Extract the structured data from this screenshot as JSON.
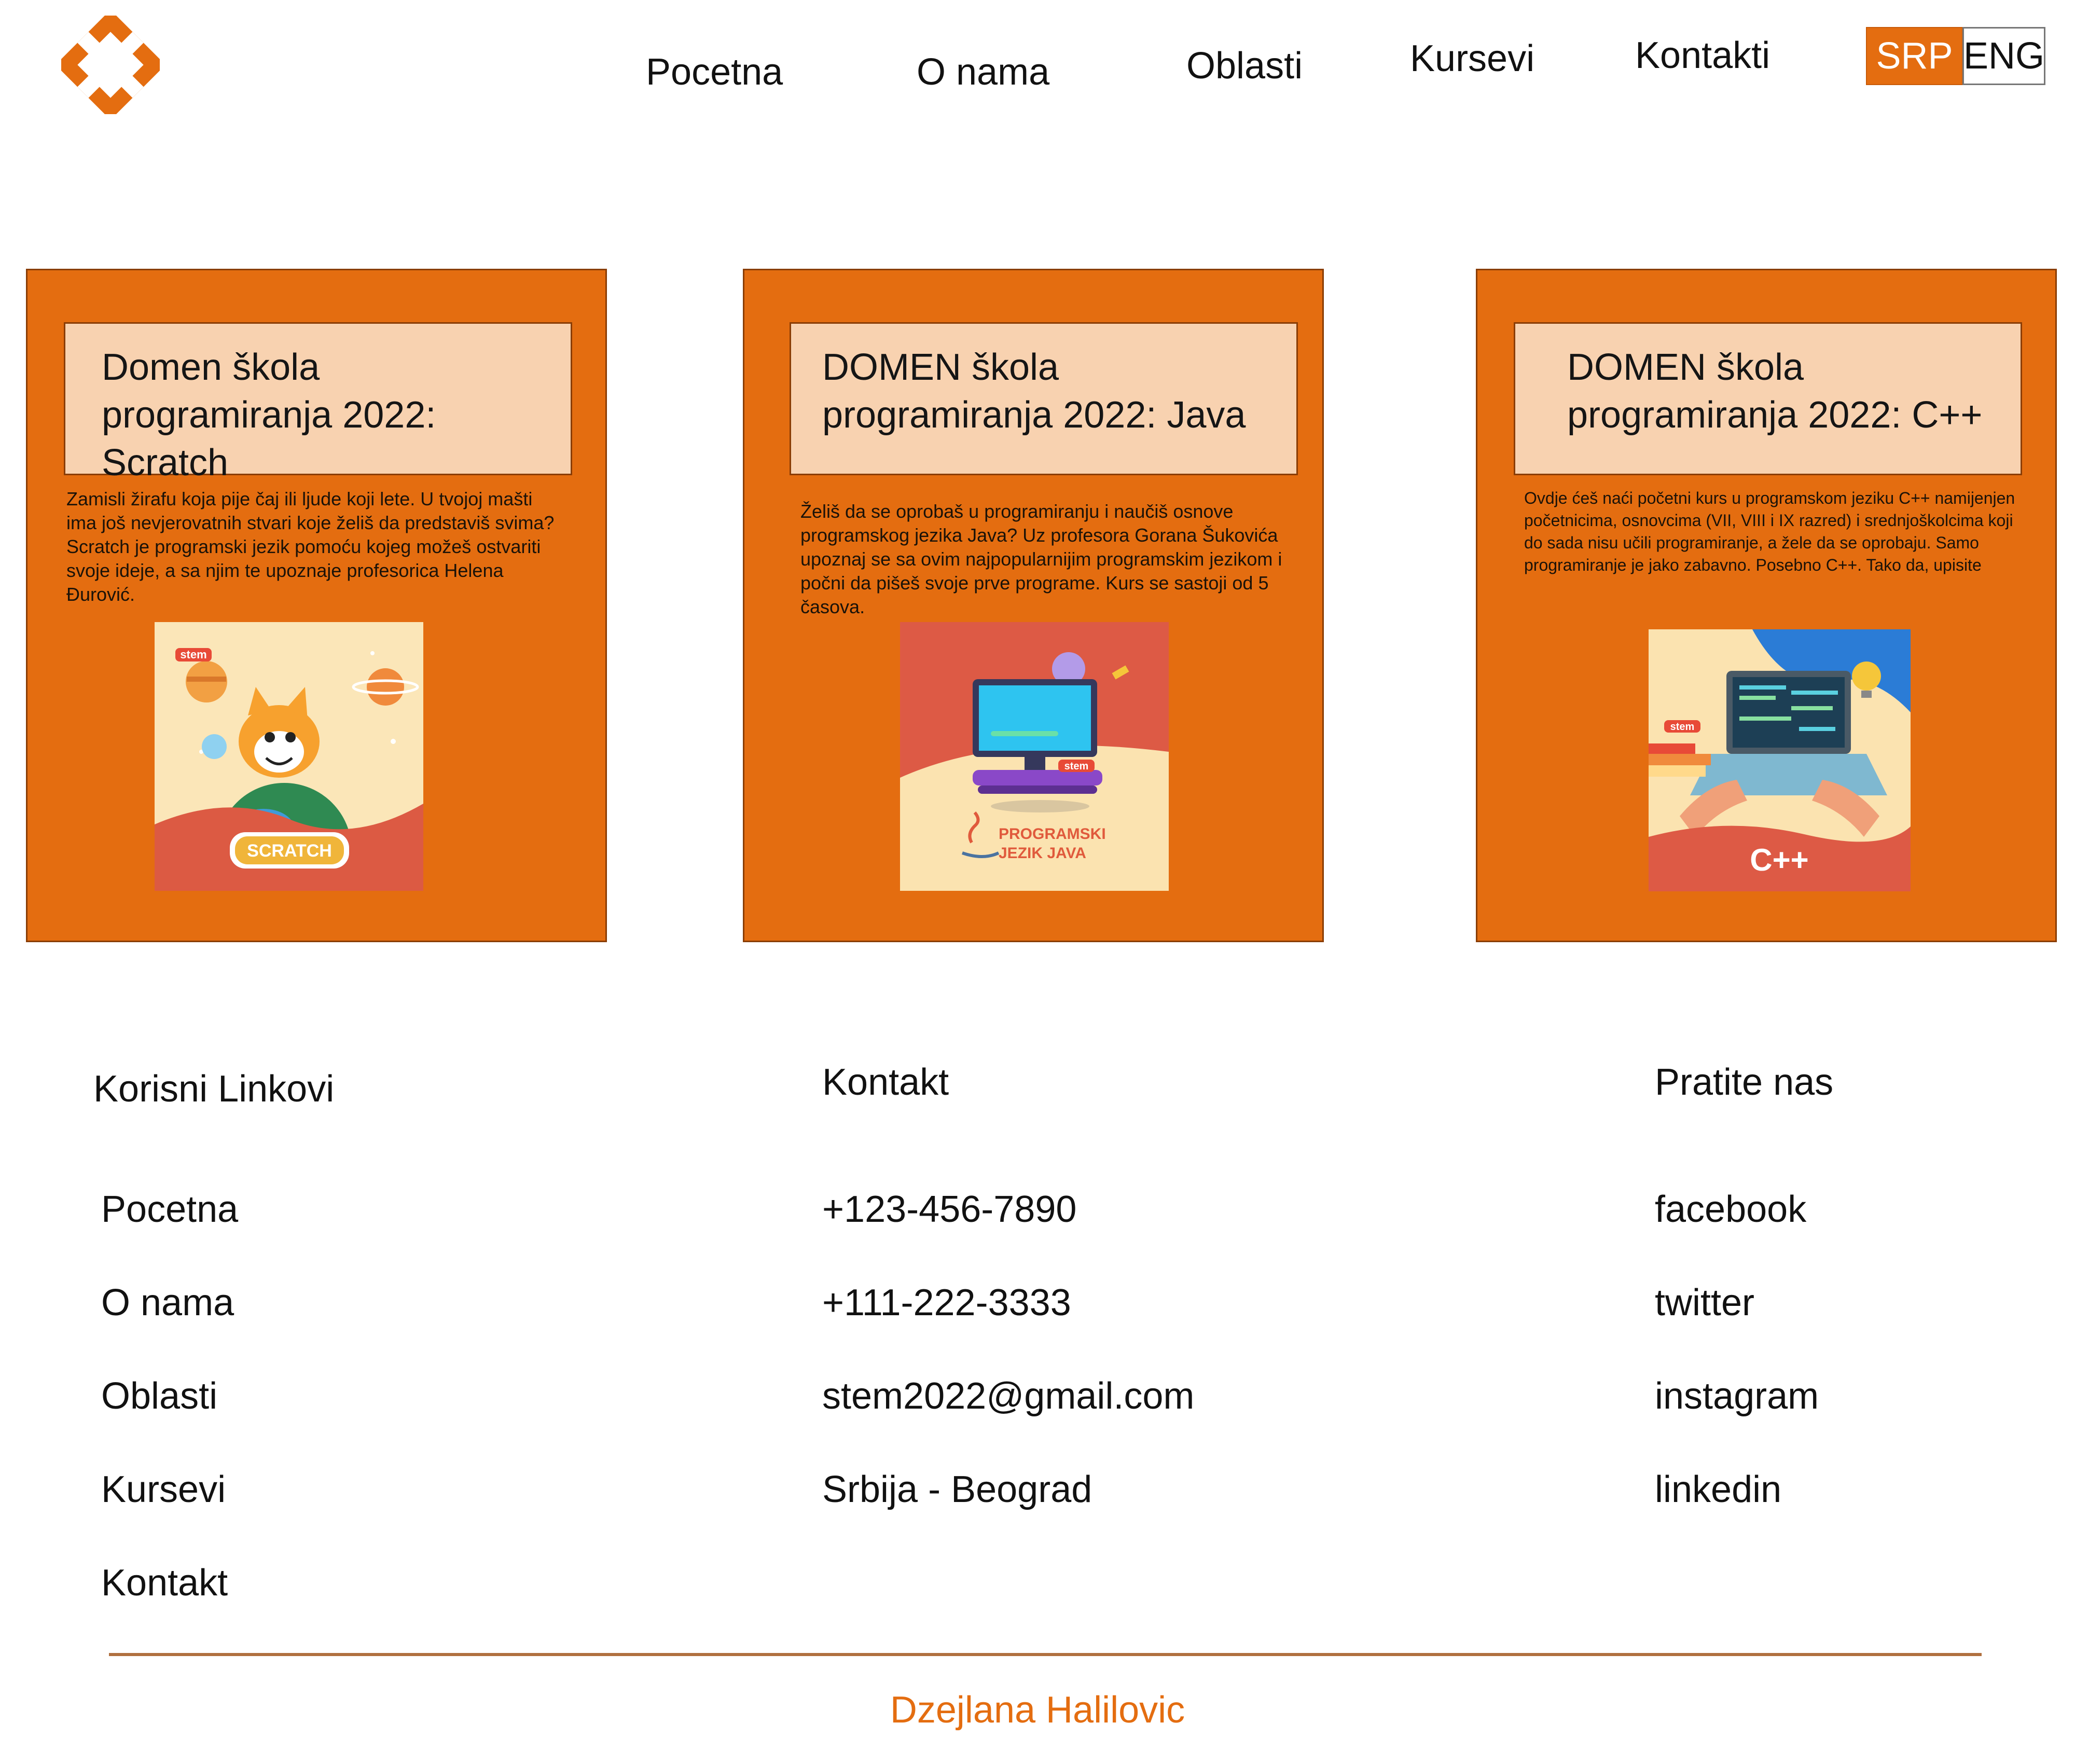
{
  "colors": {
    "accent": "#e46d10",
    "title_box": "#f8d2b0",
    "card_border": "#8a3d05",
    "divider": "#b0703f"
  },
  "header": {
    "logo_icon": "orange-diamond-logo-icon",
    "nav": [
      "Pocetna",
      "O nama",
      "Oblasti",
      "Kursevi",
      "Kontakti"
    ],
    "lang_active": "SRP",
    "lang_other": "ENG"
  },
  "cards": [
    {
      "title": "Domen škola programiranja 2022: Scratch",
      "description": "Zamisli žirafu koja pije čaj ili ljude koji lete. U tvojoj mašti ima još nevjerovatnih stvari koje želiš da predstaviš svima? Scratch je programski jezik pomoću kojeg možeš ostvariti svoje ideje, a sa njim te upoznaje profesorica Helena Đurović.",
      "image_label": "SCRATCH",
      "badge": "stem"
    },
    {
      "title": "DOMEN škola programiranja 2022: Java",
      "description": "Želiš da se oprobaš u programiranju i naučiš osnove programskog jezika Java? Uz profesora Gorana Šukovića upoznaj se sa ovim najpopularnijim programskim jezikom i počni da pišeš svoje prve programe. Kurs se sastoji od 5 časova.",
      "image_label": "PROGRAMSKI JEZIK JAVA",
      "badge": "stem"
    },
    {
      "title": "DOMEN škola programiranja 2022: C++",
      "description": "Ovdje ćeš naći početni kurs u programskom jeziku C++ namijenjen početnicima, osnovcima (VII, VIII i IX razred) i srednjoškolcima koji do sada nisu učili programiranje, a žele da se oprobaju. Samo programiranje je jako zabavno. Posebno C++. Tako da, upisite",
      "image_label": "C++",
      "badge": "stem"
    }
  ],
  "footer": {
    "links_heading": "Korisni  Linkovi",
    "links": [
      "Pocetna",
      "O nama",
      "Oblasti",
      "Kursevi",
      "Kontakt"
    ],
    "contact_heading": "Kontakt",
    "contact": [
      "+123-456-7890",
      "+111-222-3333",
      "stem2022@gmail.com",
      "Srbija - Beograd"
    ],
    "follow_heading": "Pratite nas",
    "social": [
      "facebook",
      "twitter",
      "instagram",
      "linkedin"
    ],
    "author": "Dzejlana Halilovic"
  }
}
